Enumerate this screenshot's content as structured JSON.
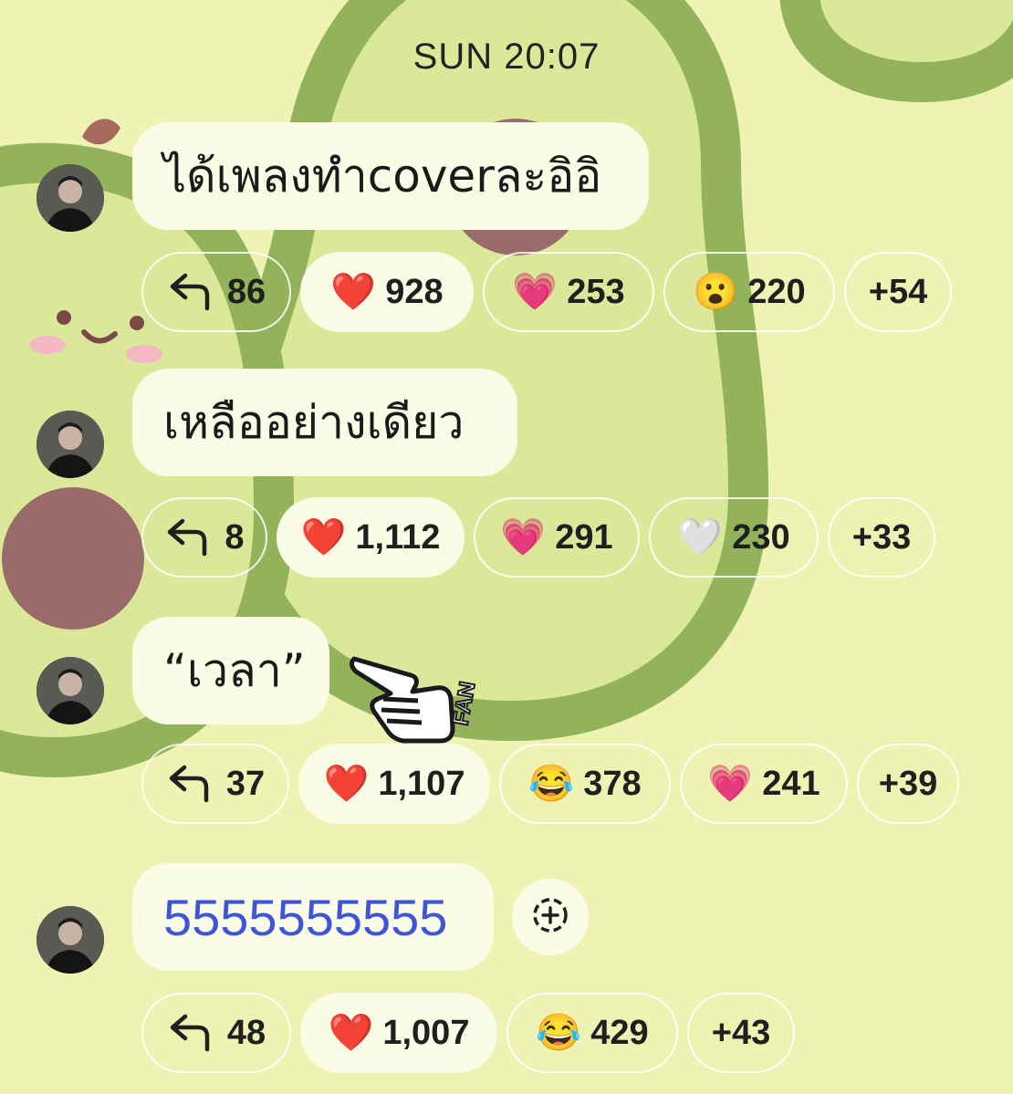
{
  "timestamp": "SUN 20:07",
  "messages": [
    {
      "text": "ได้เพลงทำcoverละอิอิ",
      "reply_count": "86",
      "reactions": [
        {
          "emoji": "❤️",
          "count": "928",
          "icon": "red-heart-icon"
        },
        {
          "emoji": "💗",
          "count": "253",
          "icon": "growing-heart-icon"
        },
        {
          "emoji": "😮",
          "count": "220",
          "icon": "surprised-face-icon"
        }
      ],
      "more": "+54"
    },
    {
      "text": "เหลืออย่างเดียว",
      "reply_count": "8",
      "reactions": [
        {
          "emoji": "❤️",
          "count": "1,112",
          "icon": "red-heart-icon"
        },
        {
          "emoji": "💗",
          "count": "291",
          "icon": "growing-heart-icon"
        },
        {
          "emoji": "🤍",
          "count": "230",
          "icon": "white-heart-icon"
        }
      ],
      "more": "+33"
    },
    {
      "text": "“เวลา”",
      "reply_count": "37",
      "reactions": [
        {
          "emoji": "❤️",
          "count": "1,107",
          "icon": "red-heart-icon"
        },
        {
          "emoji": "😂",
          "count": "378",
          "icon": "tears-of-joy-icon"
        },
        {
          "emoji": "💗",
          "count": "241",
          "icon": "growing-heart-icon"
        }
      ],
      "more": "+39"
    },
    {
      "text": "5555555555",
      "reply_count": "48",
      "reactions": [
        {
          "emoji": "❤️",
          "count": "1,007",
          "icon": "red-heart-icon"
        },
        {
          "emoji": "😂",
          "count": "429",
          "icon": "tears-of-joy-icon"
        }
      ],
      "more": "+43"
    }
  ],
  "sticker": {
    "text": "FAN",
    "icon": "pointing-hand-sticker"
  },
  "colors": {
    "background": "#eef3b4",
    "avocado_outline": "#93b35a",
    "avocado_flesh": "#dbe89a",
    "avocado_pit": "#9a6b6b",
    "bubble": "#fbfce6",
    "link_text": "#3f55d8"
  }
}
